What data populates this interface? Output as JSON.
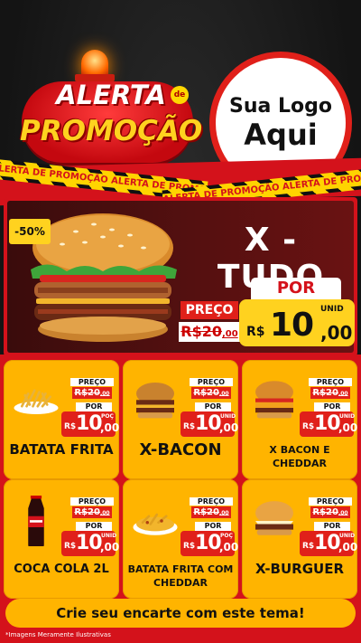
{
  "header": {
    "alerta": "ALERTA",
    "de": "de",
    "promocao": "PROMOÇÃO",
    "logo_line1": "Sua Logo",
    "logo_line2": "Aqui"
  },
  "tape_text": "ALERTA DE PROMOÇÃO   ALERTA DE PROMOÇÃO   ALERTA DE PROMOÇÃO",
  "hero": {
    "discount": "-50%",
    "title": "X - TUDO",
    "preco_label": "PREÇO",
    "old_price_int": "R$20",
    "old_price_cents": ",00",
    "por_label": "POR",
    "currency": "R$",
    "price_int": "10",
    "price_cents": ",00",
    "unid": "UNID"
  },
  "products": [
    {
      "name": "BATATA FRITA",
      "preco_label": "PREÇO",
      "old_int": "R$20",
      "old_cents": ",00",
      "por_label": "POR",
      "currency": "R$",
      "price_int": "10",
      "price_cents": ",00",
      "unit": "POÇ",
      "image": "fries"
    },
    {
      "name": "X-BACON",
      "preco_label": "PREÇO",
      "old_int": "R$20",
      "old_cents": ",00",
      "por_label": "POR",
      "currency": "R$",
      "price_int": "10",
      "price_cents": ",00",
      "unit": "UNID",
      "image": "burger"
    },
    {
      "name": "X BACON E CHEDDAR",
      "preco_label": "PREÇO",
      "old_int": "R$20",
      "old_cents": ",00",
      "por_label": "POR",
      "currency": "R$",
      "price_int": "10",
      "price_cents": ",00",
      "unit": "UNID",
      "image": "burger-cheddar"
    },
    {
      "name": "COCA COLA 2L",
      "preco_label": "PREÇO",
      "old_int": "R$20",
      "old_cents": ",00",
      "por_label": "POR",
      "currency": "R$",
      "price_int": "10",
      "price_cents": ",00",
      "unit": "UNID",
      "image": "soda-bottle"
    },
    {
      "name": "BATATA FRITA COM CHEDDAR",
      "preco_label": "PREÇO",
      "old_int": "R$20",
      "old_cents": ",00",
      "por_label": "POR",
      "currency": "R$",
      "price_int": "10",
      "price_cents": ",00",
      "unit": "POÇ",
      "image": "fries-cheddar"
    },
    {
      "name": "X-BURGUER",
      "preco_label": "PREÇO",
      "old_int": "R$20",
      "old_cents": ",00",
      "por_label": "POR",
      "currency": "R$",
      "price_int": "10",
      "price_cents": ",00",
      "unit": "UNID",
      "image": "cheeseburger"
    }
  ],
  "footer": {
    "cta": "Crie seu encarte com este tema!",
    "disclaimer": "*Imagens Meramente Ilustrativas"
  },
  "colors": {
    "primary_red": "#d4121b",
    "accent_yellow": "#ffd21f",
    "card_orange": "#ffb400"
  }
}
